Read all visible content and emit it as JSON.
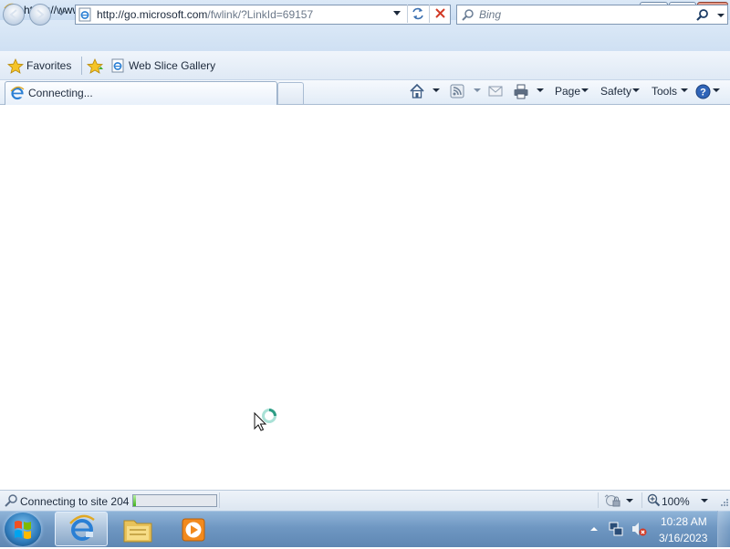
{
  "window": {
    "title": "https://www.msn.com/?ocid=iehp - Windows Internet Explorer",
    "minimize_icon": "minimize-icon",
    "maximize_icon": "restore-icon",
    "close_icon": "close-icon"
  },
  "navigation": {
    "address_host": "http://go.microsoft.com",
    "address_path": "/fwlink/?LinkId=69157",
    "search_placeholder": "Bing"
  },
  "favorites_bar": {
    "favorites_label": "Favorites",
    "web_slice_label": "Web Slice Gallery"
  },
  "tabs": [
    {
      "label": "Connecting...",
      "active": true
    }
  ],
  "command_bar": {
    "page_label": "Page",
    "safety_label": "Safety",
    "tools_label": "Tools"
  },
  "status_bar": {
    "text": "Connecting to site 204",
    "progress_fraction": 0.03,
    "zoom": "100%"
  },
  "taskbar": {
    "pinned": [
      "internet-explorer",
      "windows-explorer",
      "media-player"
    ],
    "clock_time": "10:28 AM",
    "clock_date": "3/16/2023"
  },
  "colors": {
    "chrome_blue": "#dce9f7",
    "close_red": "#c7452a",
    "progress_green": "#41b31c",
    "taskbar_blue": "#6f97c2"
  }
}
